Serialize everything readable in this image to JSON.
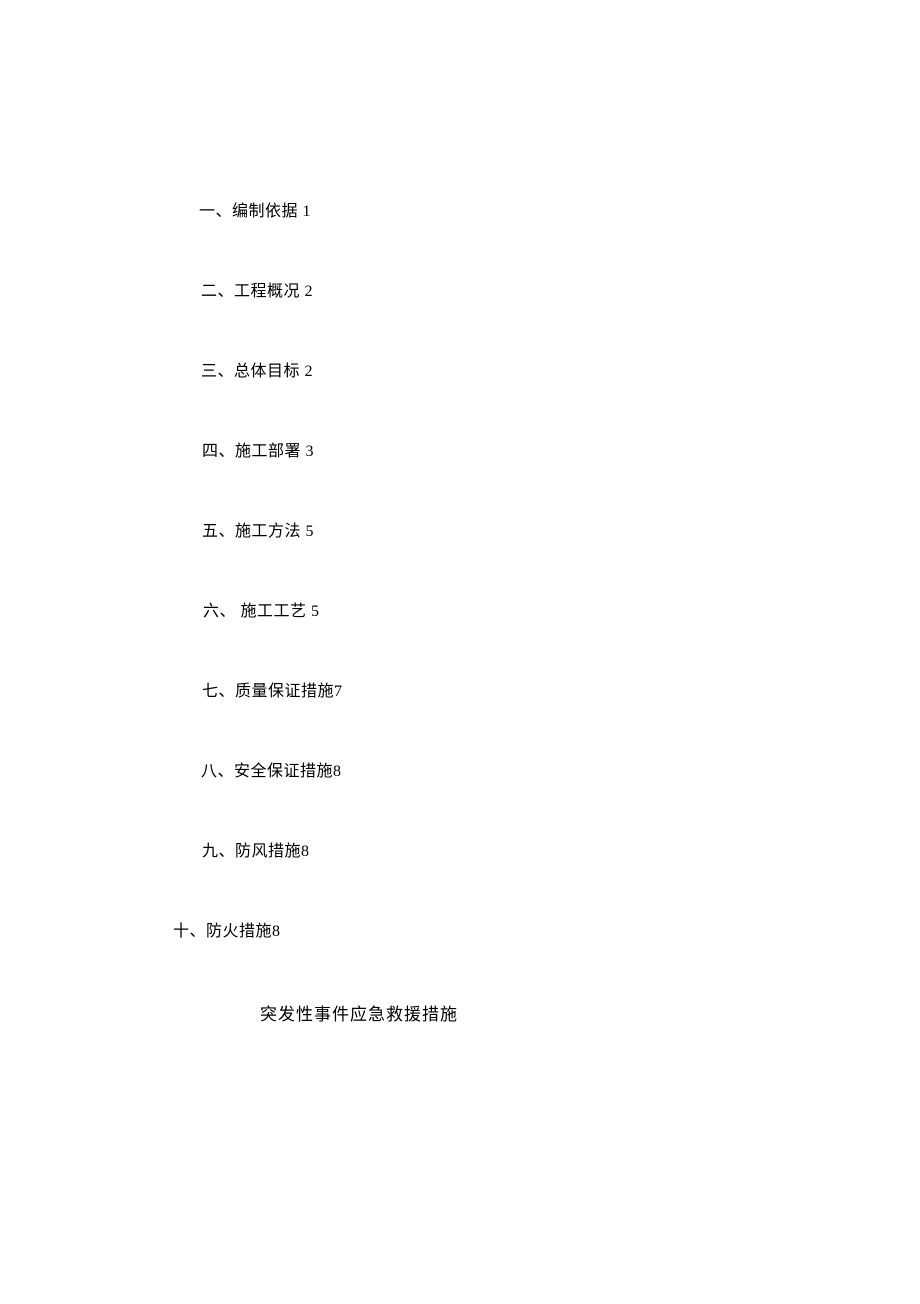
{
  "toc": {
    "items": [
      {
        "label": "一、编制依据",
        "page": "1"
      },
      {
        "label": "二、工程概况",
        "page": "2"
      },
      {
        "label": "三、总体目标",
        "page": "2"
      },
      {
        "label": "四、施工部署",
        "page": "3"
      },
      {
        "label": "五、施工方法",
        "page": "5"
      },
      {
        "label": "六、 施工工艺",
        "page": "5"
      },
      {
        "label": "七、质量保证措施",
        "page": "7"
      },
      {
        "label": "八、安全保证措施",
        "page": "8"
      },
      {
        "label": "九、防风措施",
        "page": "8"
      },
      {
        "label": "十、防火措施",
        "page": "8"
      }
    ]
  },
  "section_title": "突发性事件应急救援措施"
}
